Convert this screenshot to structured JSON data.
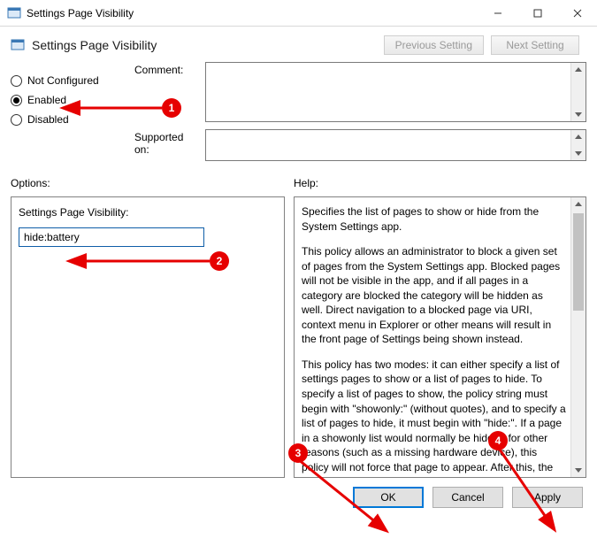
{
  "window": {
    "title": "Settings Page Visibility"
  },
  "header": {
    "title": "Settings Page Visibility"
  },
  "nav": {
    "prev": "Previous Setting",
    "next": "Next Setting"
  },
  "state": {
    "not_configured": "Not Configured",
    "enabled": "Enabled",
    "disabled": "Disabled",
    "selected": "enabled"
  },
  "comment_label": "Comment:",
  "supported_label": "Supported on:",
  "options_label": "Options:",
  "help_label": "Help:",
  "options": {
    "field_label": "Settings Page Visibility:",
    "value": "hide:battery"
  },
  "help": {
    "p1": "Specifies the list of pages to show or hide from the System Settings app.",
    "p2": "This policy allows an administrator to block a given set of pages from the System Settings app. Blocked pages will not be visible in the app, and if all pages in a category are blocked the category will be hidden as well. Direct navigation to a blocked page via URI, context menu in Explorer or other means will result in the front page of Settings being shown instead.",
    "p3": "This policy has two modes: it can either specify a list of settings pages to show or a list of pages to hide. To specify a list of pages to show, the policy string must begin with \"showonly:\" (without quotes), and to specify a list of pages to hide, it must begin with \"hide:\". If a page in a showonly list would normally be hidden for other reasons (such as a missing hardware device), this policy will not force that page to appear. After this, the policy string must contain a semicolon-delimited list of settings page identifiers. The identifier for any given settings page is the published URI for that page, minus the \"ms-settings:\" protocol part."
  },
  "buttons": {
    "ok": "OK",
    "cancel": "Cancel",
    "apply": "Apply"
  },
  "annotations": {
    "b1": "1",
    "b2": "2",
    "b3": "3",
    "b4": "4"
  }
}
